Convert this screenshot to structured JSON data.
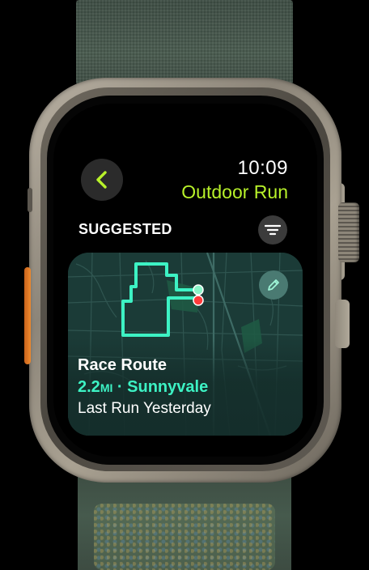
{
  "watch": {
    "time": "10:09",
    "app_title": "Outdoor Run"
  },
  "header": {
    "back_icon": "chevron-left-icon",
    "filter_icon": "filter-lines-icon"
  },
  "section": {
    "label": "SUGGESTED"
  },
  "route_card": {
    "name": "Race Route",
    "distance_value": "2.2",
    "distance_unit": "MI",
    "separator": " · ",
    "location": "Sunnyvale",
    "last_run": "Last Run Yesterday",
    "edit_icon": "pencil-icon"
  },
  "colors": {
    "accent_green": "#b8f22a",
    "route_teal": "#3df2c4",
    "map_bg": "#1b3b37",
    "start_marker": "#8cf5c9",
    "end_marker": "#ff3b3b"
  }
}
